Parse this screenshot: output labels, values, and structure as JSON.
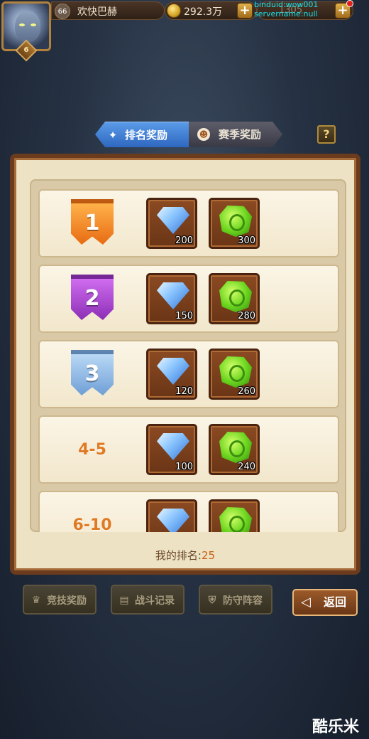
{
  "player": {
    "level": "66",
    "name": "欢快巴赫",
    "vip": "6",
    "gold": "292.3万",
    "diamond": "1305"
  },
  "debug": {
    "line1": "binduid:wow001",
    "line2": "servername:null"
  },
  "tabs": [
    {
      "label": "排名奖励",
      "icon": "ranking-icon",
      "active": true
    },
    {
      "label": "赛季奖励",
      "icon": "medal-icon",
      "active": false
    }
  ],
  "help_label": "?",
  "rewards": [
    {
      "rank": "1",
      "style": "banner-orange",
      "diamond": "200",
      "green_gem": "300"
    },
    {
      "rank": "2",
      "style": "banner-purple",
      "diamond": "150",
      "green_gem": "280"
    },
    {
      "rank": "3",
      "style": "banner-blue",
      "diamond": "120",
      "green_gem": "260"
    },
    {
      "rank": "4-5",
      "style": "text",
      "diamond": "100",
      "green_gem": "240"
    },
    {
      "rank": "6-10",
      "style": "text",
      "diamond": "",
      "green_gem": ""
    }
  ],
  "my_rank": {
    "label": "我的排名:",
    "value": "25"
  },
  "bottom_buttons": [
    {
      "label": "竞技奖励",
      "icon": "trophy-icon"
    },
    {
      "label": "战斗记录",
      "icon": "book-icon"
    },
    {
      "label": "防守阵容",
      "icon": "shield-icon"
    }
  ],
  "return_label": "返回",
  "watermark": "酷乐米",
  "colors": {
    "accent_blue": "#2e67c0",
    "panel_bg": "#eee2c4",
    "panel_border": "#6a3b1d",
    "rank_value": "#c65f12"
  }
}
